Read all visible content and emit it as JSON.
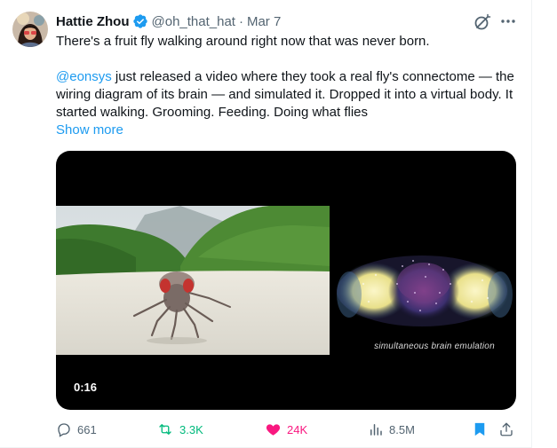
{
  "tweet": {
    "author": {
      "name": "Hattie Zhou",
      "handle": "@oh_that_hat",
      "separator": "·",
      "date": "Mar 7"
    },
    "paragraph_1": "There's a fruit fly walking around right now that was never born.",
    "mention": "@eonsys",
    "paragraph_2_rest": " just released a video where they took a real fly's connectome — the wiring diagram of its brain — and simulated it. Dropped it into a virtual body. It started walking. Grooming. Feeding. Doing what flies",
    "show_more": "Show more"
  },
  "media": {
    "caption": "simultaneous brain emulation",
    "timestamp": "0:16"
  },
  "actions": {
    "replies": "661",
    "reposts": "3.3K",
    "likes": "24K",
    "views": "8.5M"
  },
  "colors": {
    "accent": "#1d9bf0",
    "repost": "#00ba7c",
    "like": "#f91880",
    "muted": "#536471"
  },
  "icons": {
    "verified": "verified-badge-icon",
    "grok": "grok-icon",
    "more": "more-dots-icon",
    "reply": "reply-icon",
    "repost": "repost-icon",
    "like": "heart-icon",
    "views": "views-chart-icon",
    "bookmark": "bookmark-icon",
    "share": "share-icon"
  }
}
